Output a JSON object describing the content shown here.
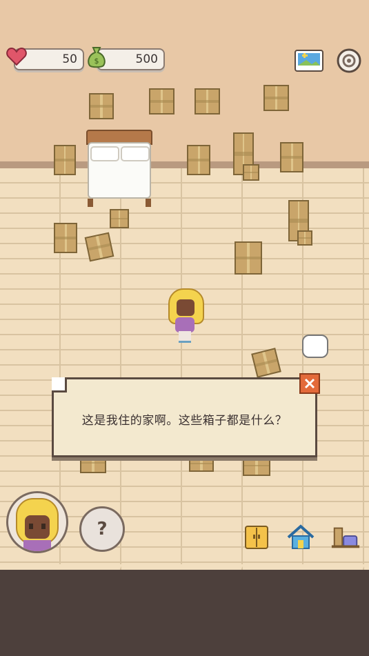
{
  "hud": {
    "health_value": "50",
    "money_value": "500",
    "icons": [
      "heart-icon",
      "money-bag-icon",
      "photo-album-icon",
      "settings-gear-icon"
    ]
  },
  "dialog": {
    "text": "这是我住的家啊。这些箱子都是什么？",
    "close_icon": "close-icon"
  },
  "controls": {
    "help_label": "?",
    "icons": [
      "character-avatar",
      "help-icon",
      "wardrobe-icon",
      "house-icon",
      "furniture-icon"
    ]
  },
  "colors": {
    "wall": "#e8c8a6",
    "floor": "#f2dfc0",
    "dialog_bg": "#f3e9cf",
    "close_button": "#e36a3a",
    "heart": "#e0566a"
  }
}
